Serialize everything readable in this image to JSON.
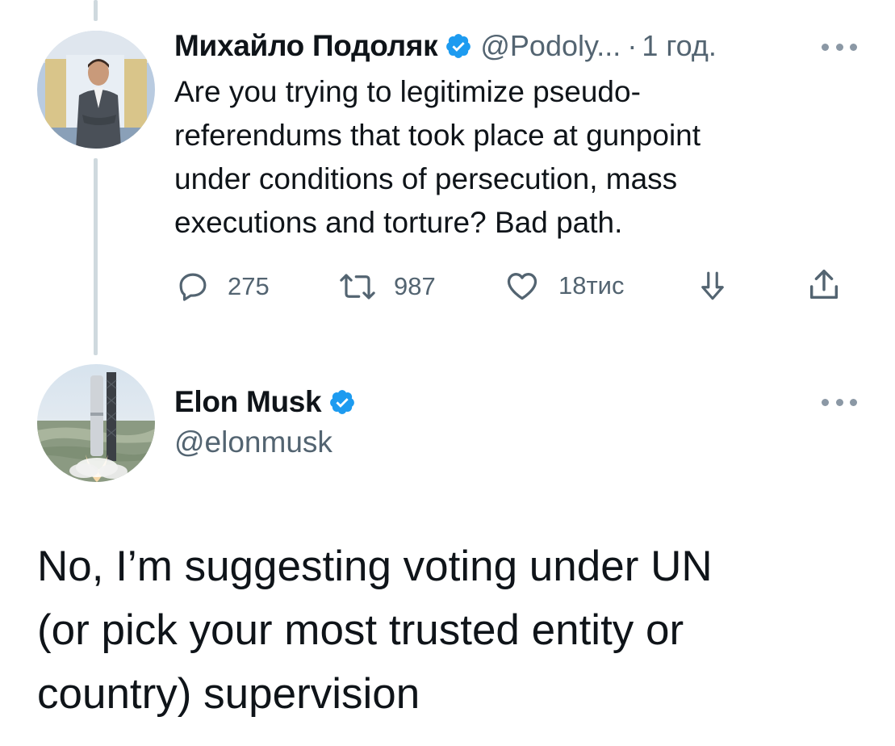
{
  "reply_to_tweet": {
    "author": {
      "display_name": "Михайло Подоляк",
      "handle": "@Podoly...",
      "verified": true,
      "avatar_icon": "person-portrait-avatar"
    },
    "separator": "·",
    "time": "1 год.",
    "text_lines": [
      "Are you trying to legitimize pseudo-",
      "referendums that took place at gunpoint",
      "under conditions of persecution, mass",
      "executions and torture? Bad path."
    ],
    "actions": {
      "reply_count": "275",
      "retweet_count": "987",
      "like_count": "18тис"
    }
  },
  "main_tweet": {
    "author": {
      "display_name": "Elon Musk",
      "handle": "@elonmusk",
      "verified": true,
      "avatar_icon": "rocket-launch-avatar"
    },
    "text_lines": [
      "No, I’m suggesting voting under UN",
      "(or pick your most trusted entity or",
      "country) supervision"
    ]
  },
  "colors": {
    "verified_blue": "#1d9bf0",
    "secondary_text": "#536471",
    "thread_line": "#cfd9de",
    "primary_text": "#0f1419"
  }
}
